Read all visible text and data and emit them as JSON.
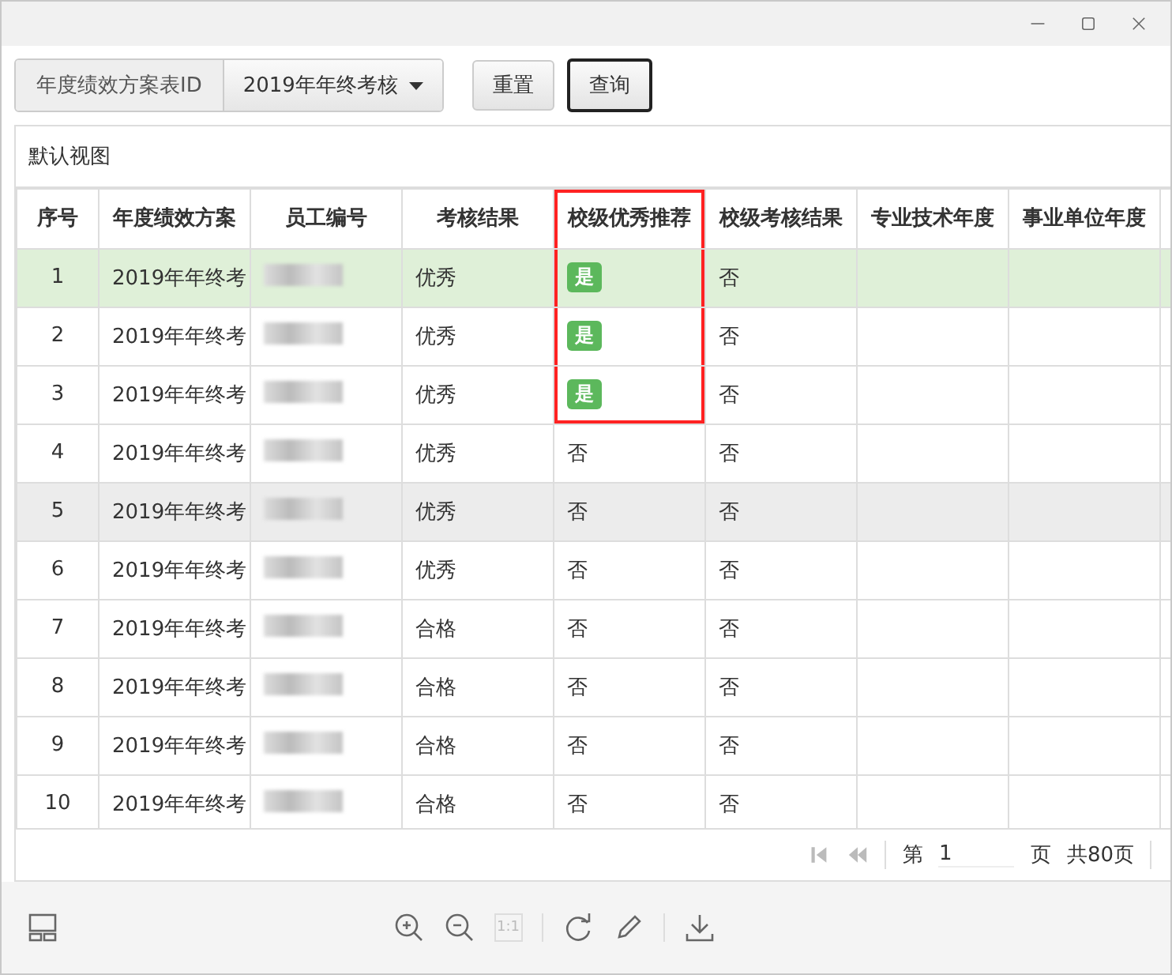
{
  "toolbar": {
    "field_label": "年度绩效方案表ID",
    "dropdown_value": "2019年年终考核",
    "buttons": [
      {
        "label": "重置",
        "focused": false
      },
      {
        "label": "查询",
        "focused": true
      }
    ]
  },
  "panel": {
    "title": "默认视图"
  },
  "table": {
    "columns": [
      {
        "label": "序号",
        "outlined": false
      },
      {
        "label": "年度绩效方案",
        "outlined": false
      },
      {
        "label": "员工编号",
        "outlined": false
      },
      {
        "label": "考核结果",
        "outlined": false
      },
      {
        "label": "校级优秀推荐",
        "outlined": true
      },
      {
        "label": "校级考核结果",
        "outlined": false
      },
      {
        "label": "专业技术年度",
        "outlined": false
      },
      {
        "label": "事业单位年度",
        "outlined": false
      }
    ],
    "rows": [
      {
        "no": "1",
        "plan": "2019年年终考",
        "result": "优秀",
        "recommend": "是",
        "recommend_badge": true,
        "school_result": "否",
        "selected": true,
        "hovered": false
      },
      {
        "no": "2",
        "plan": "2019年年终考",
        "result": "优秀",
        "recommend": "是",
        "recommend_badge": true,
        "school_result": "否",
        "selected": false,
        "hovered": false
      },
      {
        "no": "3",
        "plan": "2019年年终考",
        "result": "优秀",
        "recommend": "是",
        "recommend_badge": true,
        "school_result": "否",
        "selected": false,
        "hovered": false
      },
      {
        "no": "4",
        "plan": "2019年年终考",
        "result": "优秀",
        "recommend": "否",
        "recommend_badge": false,
        "school_result": "否",
        "selected": false,
        "hovered": false
      },
      {
        "no": "5",
        "plan": "2019年年终考",
        "result": "优秀",
        "recommend": "否",
        "recommend_badge": false,
        "school_result": "否",
        "selected": false,
        "hovered": true
      },
      {
        "no": "6",
        "plan": "2019年年终考",
        "result": "优秀",
        "recommend": "否",
        "recommend_badge": false,
        "school_result": "否",
        "selected": false,
        "hovered": false
      },
      {
        "no": "7",
        "plan": "2019年年终考",
        "result": "合格",
        "recommend": "否",
        "recommend_badge": false,
        "school_result": "否",
        "selected": false,
        "hovered": false
      },
      {
        "no": "8",
        "plan": "2019年年终考",
        "result": "合格",
        "recommend": "否",
        "recommend_badge": false,
        "school_result": "否",
        "selected": false,
        "hovered": false
      },
      {
        "no": "9",
        "plan": "2019年年终考",
        "result": "合格",
        "recommend": "否",
        "recommend_badge": false,
        "school_result": "否",
        "selected": false,
        "hovered": false
      },
      {
        "no": "10",
        "plan": "2019年年终考",
        "result": "合格",
        "recommend": "否",
        "recommend_badge": false,
        "school_result": "否",
        "selected": false,
        "hovered": false
      }
    ]
  },
  "pagination": {
    "first_disabled": true,
    "prev_disabled": true,
    "page_prefix": "第",
    "page_value": "1",
    "page_suffix": "页",
    "total": "共80页"
  },
  "viewer_bar": {
    "actual_size": {
      "label": "1:1",
      "disabled": true
    }
  }
}
